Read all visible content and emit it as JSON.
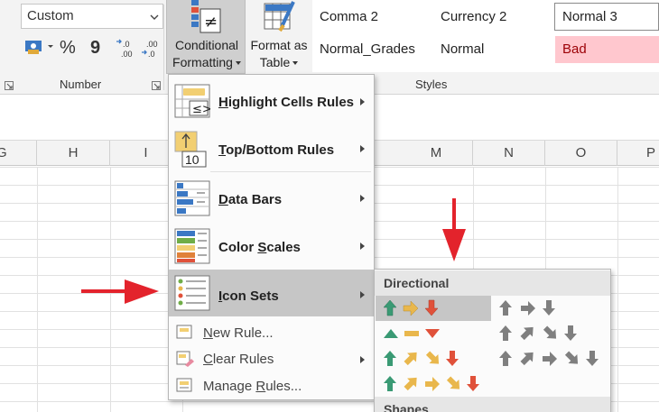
{
  "ribbon": {
    "number_format": "Custom",
    "number_group_label": "Number",
    "styles_group_label": "Styles",
    "conditional_formatting": {
      "line1": "Conditional",
      "line2": "Formatting"
    },
    "format_as_table": {
      "line1": "Format as",
      "line2": "Table"
    },
    "styles": {
      "comma2": "Comma 2",
      "currency2": "Currency 2",
      "normal3": "Normal 3",
      "normal_grades": "Normal_Grades",
      "normal": "Normal",
      "bad": "Bad"
    },
    "number_symbols": {
      "percent": "%",
      "comma": "9"
    }
  },
  "columns": [
    "G",
    "H",
    "I",
    "M",
    "N",
    "O",
    "P"
  ],
  "menu": {
    "highlight": {
      "pre": "",
      "key": "H",
      "post": "ighlight Cells Rules"
    },
    "topbottom": {
      "pre": "",
      "key": "T",
      "post": "op/Bottom Rules"
    },
    "databars": {
      "pre": "",
      "key": "D",
      "post": "ata Bars"
    },
    "colorscales": {
      "pre": "Color ",
      "key": "S",
      "post": "cales"
    },
    "iconsets": {
      "pre": "",
      "key": "I",
      "post": "con Sets"
    },
    "newrule": {
      "pre": "",
      "key": "N",
      "post": "ew Rule..."
    },
    "clearrules": {
      "pre": "",
      "key": "C",
      "post": "lear Rules"
    },
    "managerules": {
      "pre": "Manage ",
      "key": "R",
      "post": "ules..."
    }
  },
  "submenu": {
    "directional_header": "Directional",
    "shapes_header": "Shapes"
  },
  "colors": {
    "green": "#3a9a74",
    "yellow": "#e9b74c",
    "red": "#e0513a",
    "gray": "#7f7f7f",
    "annotation_red": "#e3232c",
    "bad_fill": "#ffc7ce"
  }
}
